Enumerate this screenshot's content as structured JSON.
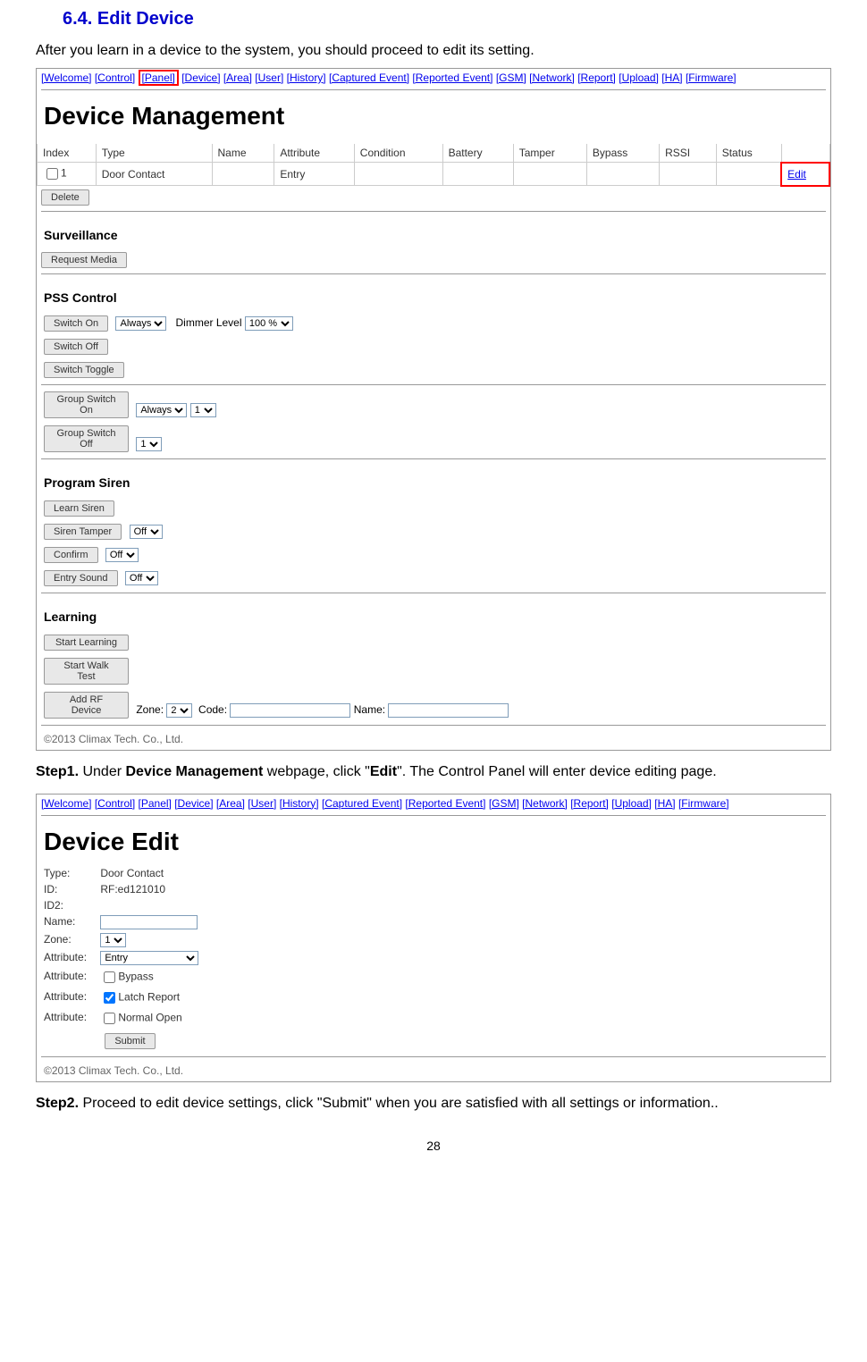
{
  "section_title": "6.4. Edit Device",
  "intro_text": "After you learn in a device to the system, you should proceed to edit its setting.",
  "nav_items": [
    "[Welcome]",
    "[Control]",
    "[Panel]",
    "[Device]",
    "[Area]",
    "[User]",
    "[History]",
    "[Captured Event]",
    "[Reported Event]",
    "[GSM]",
    "[Network]",
    "[Report]",
    "[Upload]",
    "[HA]",
    "[Firmware]"
  ],
  "screenshot1": {
    "heading": "Device Management",
    "table": {
      "headers": [
        "Index",
        "Type",
        "Name",
        "Attribute",
        "Condition",
        "Battery",
        "Tamper",
        "Bypass",
        "RSSI",
        "Status",
        ""
      ],
      "row": {
        "index": "1",
        "type": "Door Contact",
        "name": "",
        "attribute": "Entry",
        "condition": "",
        "battery": "",
        "tamper": "",
        "bypass": "",
        "rssi": "",
        "status": "",
        "edit": "Edit"
      }
    },
    "delete_btn": "Delete",
    "surveillance_heading": "Surveillance",
    "request_media_btn": "Request Media",
    "pss_heading": "PSS Control",
    "switch_on_btn": "Switch On",
    "switch_on_always": "Always",
    "dimmer_label": "Dimmer Level",
    "dimmer_value": "100 %",
    "switch_off_btn": "Switch Off",
    "switch_toggle_btn": "Switch Toggle",
    "group_switch_on_btn": "Group Switch On",
    "group_on_always": "Always",
    "group_on_num": "1",
    "group_switch_off_btn": "Group Switch Off",
    "group_off_num": "1",
    "siren_heading": "Program Siren",
    "learn_siren_btn": "Learn Siren",
    "siren_tamper_btn": "Siren Tamper",
    "siren_tamper_val": "Off",
    "confirm_btn": "Confirm",
    "confirm_val": "Off",
    "entry_sound_btn": "Entry Sound",
    "entry_sound_val": "Off",
    "learning_heading": "Learning",
    "start_learning_btn": "Start Learning",
    "start_walk_test_btn": "Start Walk Test",
    "add_rf_device_btn": "Add RF Device",
    "zone_label": "Zone:",
    "zone_val": "2",
    "code_label": "Code:",
    "name_label": "Name:",
    "copyright": "©2013 Climax Tech. Co., Ltd."
  },
  "step1_prefix": "Step1. ",
  "step1_text1": "Under ",
  "step1_bold1": "Device Management",
  "step1_text2": " webpage, click \"",
  "step1_bold2": "Edit",
  "step1_text3": "\". The Control Panel will enter device editing page.",
  "screenshot2": {
    "heading": "Device Edit",
    "type_label": "Type:",
    "type_val": "Door Contact",
    "id_label": "ID:",
    "id_val": "RF:ed121010",
    "id2_label": "ID2:",
    "name_label": "Name:",
    "zone_label": "Zone:",
    "zone_val": "1",
    "attr_label": "Attribute:",
    "attr_val": "Entry",
    "bypass_label": "Bypass",
    "latch_label": "Latch Report",
    "normal_open_label": "Normal Open",
    "submit_btn": "Submit",
    "copyright": "©2013 Climax Tech. Co., Ltd."
  },
  "step2_prefix": "Step2. ",
  "step2_text": "Proceed to edit device settings, click \"Submit\" when you are satisfied with all settings or information..",
  "page_num": "28"
}
